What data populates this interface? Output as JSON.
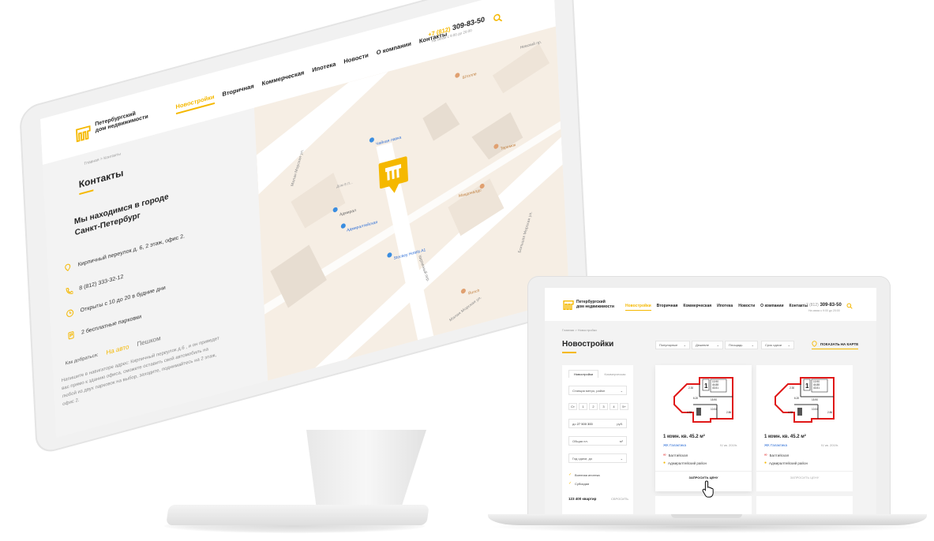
{
  "brand": {
    "line1": "Петербургский",
    "line2": "дом недвижимости",
    "accent_color": "#f5b800"
  },
  "desktop": {
    "nav": [
      "Новостройки",
      "Вторичная",
      "Коммерческая",
      "Ипотека",
      "Новости",
      "О компании",
      "Контакты"
    ],
    "nav_active_index": 0,
    "phone_prefix": "+7 (812)",
    "phone_number": "309-83-50",
    "phone_sub": "На связи с 9:00 до 20:00",
    "breadcrumb": "Главная > Контакты",
    "title": "Контакты",
    "city_heading": "Мы находимся в городе Санкт-Петербург",
    "info": [
      {
        "icon": "map-pin-icon",
        "text": "Кирпичный переулок д. 6, 2 этаж, офис 2."
      },
      {
        "icon": "phone-icon",
        "text": "8 (812) 333-32-12"
      },
      {
        "icon": "clock-icon",
        "text": "Открыты с 10 до 20 в будние дни"
      },
      {
        "icon": "parking-icon",
        "text": "2 бесплатные парковки"
      }
    ],
    "how_label": "Как добраться:",
    "how_car": "На авто",
    "how_walk": "Пешком",
    "description": "Напишите в навигаторе адрес: Кирпичный переулок д.6 , и он приведет вас прямо к зданию офиса, сможете оставить свой автомобиль на любой из двух парковок на выбор, заходите, поднимайтесь на 2 этаж, офис 2.",
    "map_labels": {
      "street1": "Невский пр.",
      "street2": "Малая Морская ул.",
      "street3": "Большая Морская ул.",
      "street4": "Кирпичный пер.",
      "street5": "Малая Морская ул.",
      "poi1": "Чайная лавка",
      "poi2": "Штолле",
      "poi3": "Теремок",
      "poi4": "Макдоналдс",
      "poi5": "Адмирал",
      "metro": "Адмиралтейская",
      "poi6": "Stockey Hotels A1",
      "poi7": "Bunch",
      "bldg": "Дом 8 Л..."
    }
  },
  "laptop": {
    "nav": [
      "Новостройки",
      "Вторичная",
      "Коммерческая",
      "Ипотека",
      "Новости",
      "О компании",
      "Контакты"
    ],
    "phone_prefix": "+7 (812)",
    "phone_number": "309-83-50",
    "phone_sub": "На связи с 9:00 до 20:00",
    "breadcrumb": "Главная > Новостройки",
    "title": "Новостройки",
    "sorts": [
      "Популярные",
      "Дешевле",
      "Площадь",
      "Срок сдачи"
    ],
    "show_map": "ПОКАЗАТЬ НА КАРТЕ",
    "filter": {
      "tab_active": "Новостройки",
      "tab_other": "Коммерческая",
      "metro_placeholder": "Станция метро, район",
      "rooms": [
        "Ст",
        "1",
        "2",
        "3",
        "4",
        "5+"
      ],
      "price_to_label": "до",
      "price_to_value": "27 500 300",
      "price_unit": "руб.",
      "area_label": "Общая пл.",
      "area_unit": "м²",
      "year_label": "Год сдачи, до",
      "check1": "Военная ипотека",
      "check2": "Субсидии",
      "count": "123 400 квартир",
      "reset": "СБРОСИТЬ"
    },
    "cards": [
      {
        "name": "1 комн. кв. 45.2 м²",
        "complex": "ЖК Галактика",
        "date": "IV кв. 2019г.",
        "metro": "Балтийская",
        "district": "Адмиралтейский район",
        "button": "ЗАПРОСИТЬ ЦЕНУ",
        "plan_labels": [
          "1",
          "10.90",
          "44.88",
          "43.51",
          "2.30",
          "6.20",
          "15.90",
          "4.38",
          "10.04",
          "2.86"
        ]
      },
      {
        "name": "1 комн. кв. 45.2 м²",
        "complex": "ЖК Галактика",
        "date": "IV кв. 2019г.",
        "metro": "Балтийская",
        "district": "Адмиралтейский район",
        "button": "ЗАПРОСИТЬ ЦЕНУ",
        "plan_labels": [
          "1",
          "10.90",
          "44.88",
          "43.51",
          "2.30",
          "6.20",
          "15.90",
          "4.38",
          "10.04",
          "2.86"
        ]
      }
    ]
  }
}
